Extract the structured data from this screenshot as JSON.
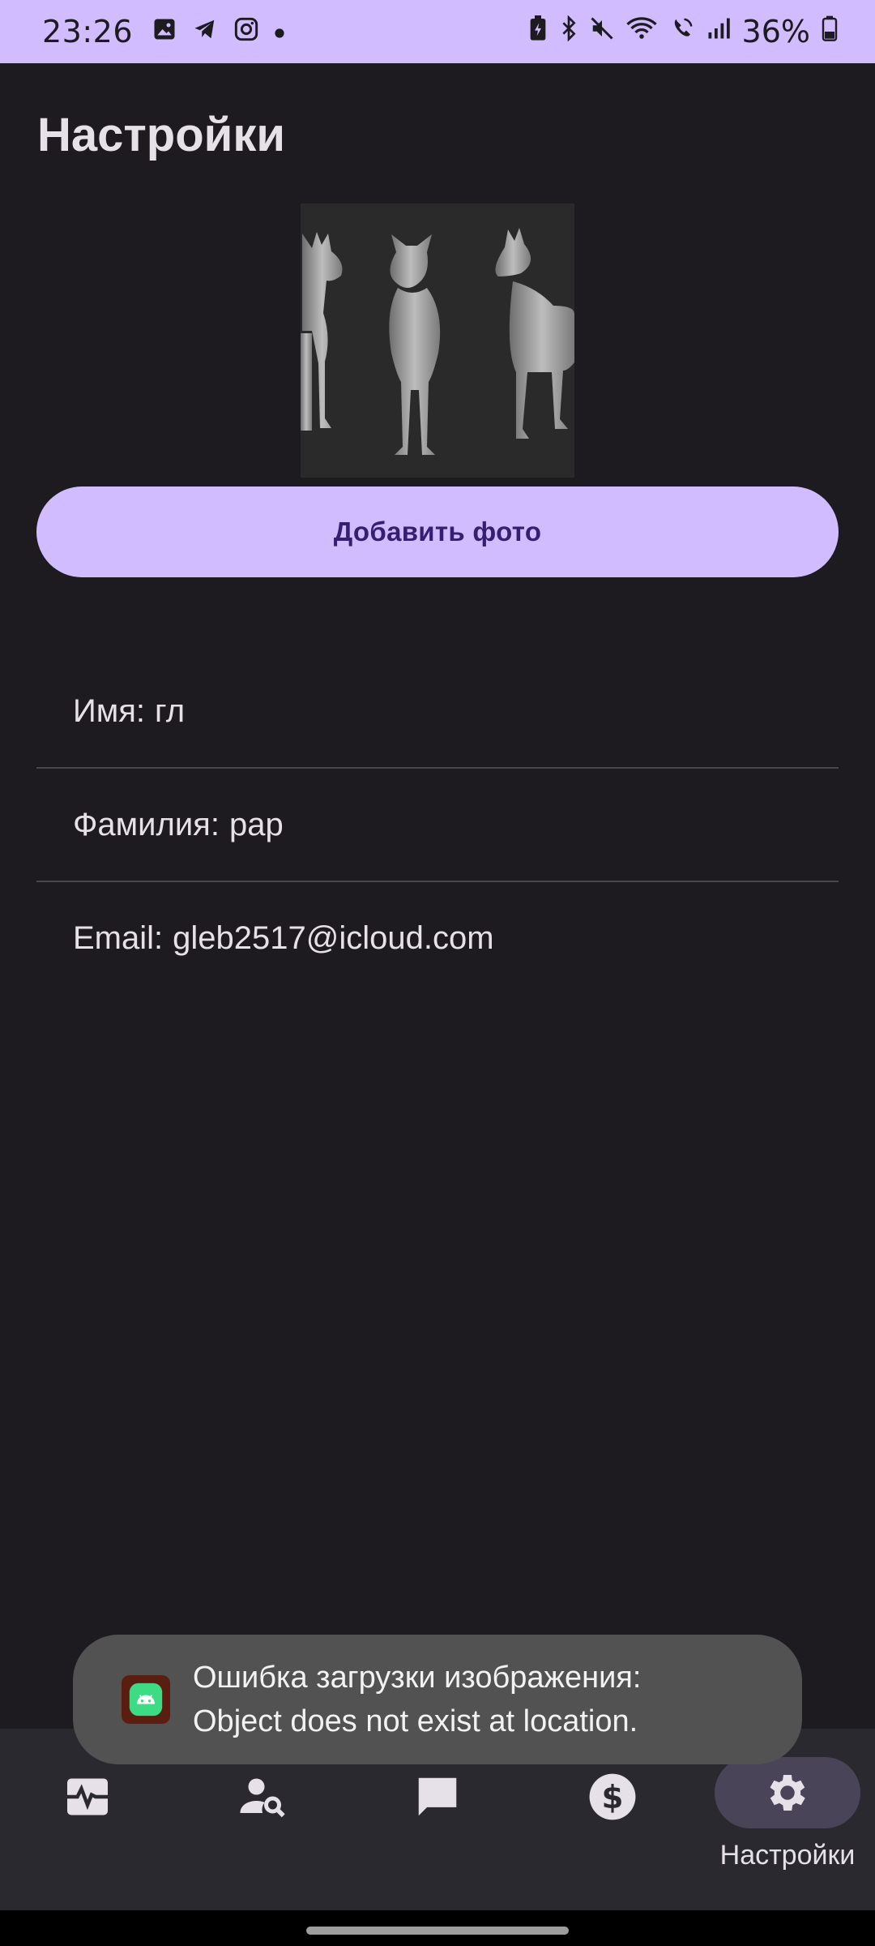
{
  "status_bar": {
    "time": "23:26",
    "notification_icons": [
      "gallery-icon",
      "telegram-icon",
      "instagram-icon",
      "dot-icon"
    ],
    "system_icons": [
      "battery-saver-icon",
      "bluetooth-icon",
      "mute-icon",
      "wifi-icon",
      "wifi-call-icon",
      "signal-icon"
    ],
    "battery": "36%",
    "bg_color": "#d0bcff"
  },
  "page": {
    "title": "Настройки"
  },
  "profile": {
    "photo_alt": "dog-statue-photo",
    "add_photo_label": "Добавить фото",
    "fields": [
      {
        "label": "Имя:",
        "value": "гл"
      },
      {
        "label": "Фамилия:",
        "value": "рар"
      },
      {
        "label": "Email:",
        "value": "gleb2517@icloud.com"
      }
    ]
  },
  "toast": {
    "line1": "Ошибка загрузки изображения:",
    "line2": "Object does not exist at location."
  },
  "bottom_nav": {
    "items": [
      {
        "icon": "activity-monitor-icon",
        "label": ""
      },
      {
        "icon": "person-search-icon",
        "label": ""
      },
      {
        "icon": "chat-icon",
        "label": ""
      },
      {
        "icon": "dollar-icon",
        "label": ""
      },
      {
        "icon": "gear-icon",
        "label": "Настройки",
        "active": true
      }
    ]
  },
  "colors": {
    "background": "#1d1b20",
    "primary": "#d0bcff",
    "on_primary": "#381e72",
    "nav_bg": "#2b2930",
    "nav_active_indicator": "#4a4458"
  }
}
